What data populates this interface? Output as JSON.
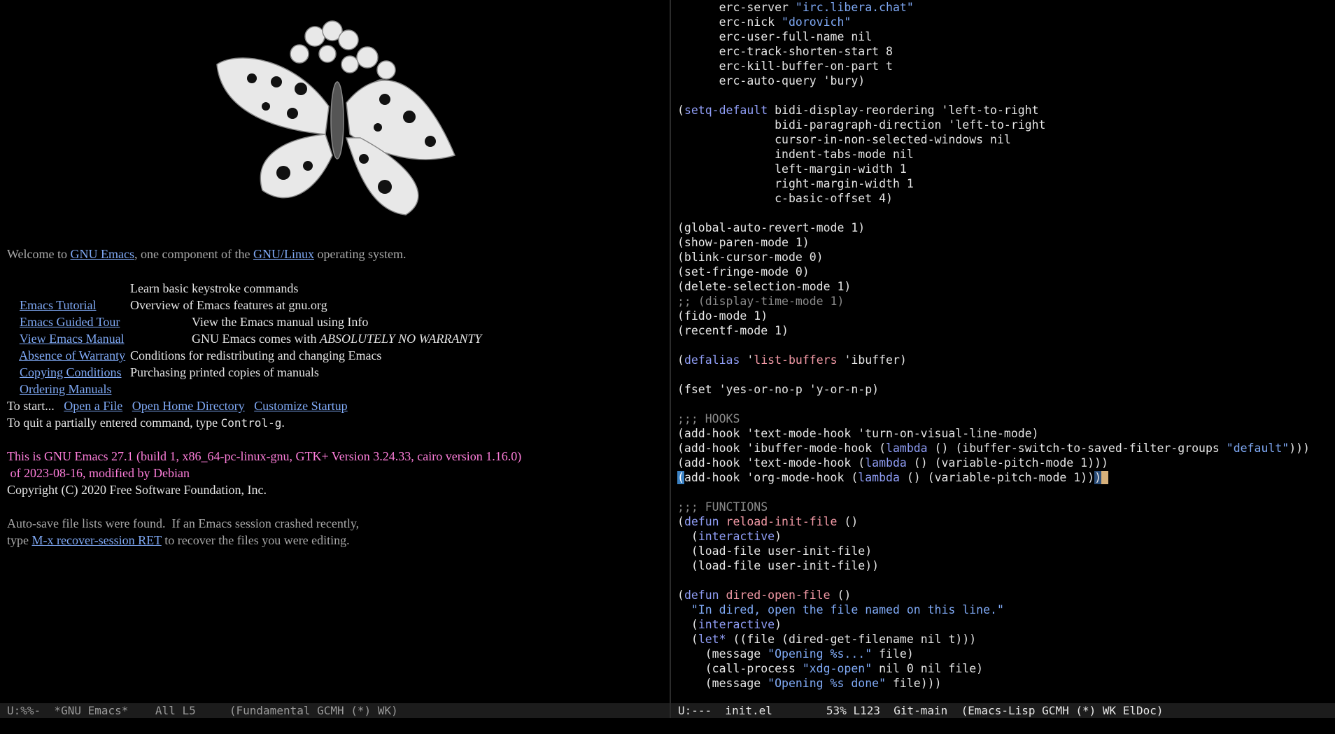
{
  "left": {
    "welcome": {
      "prefix": "Welcome to ",
      "link1": "GNU Emacs",
      "mid": ", one component of the ",
      "link2": "GNU/Linux",
      "suffix": " operating system."
    },
    "menu": [
      {
        "link": "Emacs Tutorial",
        "desc": "Learn basic keystroke commands"
      },
      {
        "link": "Emacs Guided Tour",
        "desc": "Overview of Emacs features at gnu.org"
      },
      {
        "link": "View Emacs Manual",
        "desc": "View the Emacs manual using Info"
      },
      {
        "link": "Absence of Warranty",
        "desc": "GNU Emacs comes with ",
        "desc_em": "ABSOLUTELY NO WARRANTY"
      },
      {
        "link": "Copying Conditions",
        "desc": "Conditions for redistributing and changing Emacs"
      },
      {
        "link": "Ordering Manuals",
        "desc": "Purchasing printed copies of manuals"
      }
    ],
    "start": {
      "prefix": "To start...",
      "open_file": "Open a File",
      "open_home": "Open Home Directory",
      "customize": "Customize Startup"
    },
    "quit": {
      "prefix": "To quit a partially entered command, type ",
      "key": "Control-g",
      "suffix": "."
    },
    "version1": "This is GNU Emacs 27.1 (build 1, x86_64-pc-linux-gnu, GTK+ Version 3.24.33, cairo version 1.16.0)",
    "version2": " of 2023-08-16, modified by Debian",
    "copyright": "Copyright (C) 2020 Free Software Foundation, Inc.",
    "autosave1": "Auto-save file lists were found.  If an Emacs session crashed recently,",
    "autosave2_prefix": "type ",
    "autosave2_link": "M-x recover-session RET",
    "autosave2_suffix": " to recover the files you were editing."
  },
  "modeline_left": "U:%%-  *GNU Emacs*    All L5     (Fundamental GCMH (*) WK)",
  "modeline_right": "U:---  init.el        53% L123  Git-main  (Emacs-Lisp GCMH (*) WK ElDoc)",
  "code_lines": [
    [
      [
        "",
        "      erc-server "
      ],
      [
        "str",
        "\"irc.libera.chat\""
      ]
    ],
    [
      [
        "",
        "      erc-nick "
      ],
      [
        "str",
        "\"dorovich\""
      ]
    ],
    [
      [
        "",
        "      erc-user-full-name nil"
      ]
    ],
    [
      [
        "",
        "      erc-track-shorten-start 8"
      ]
    ],
    [
      [
        "",
        "      erc-kill-buffer-on-part t"
      ]
    ],
    [
      [
        "",
        "      erc-auto-query 'bury)"
      ]
    ],
    [],
    [
      [
        "",
        "("
      ],
      [
        "kw",
        "setq-default"
      ],
      [
        "",
        " bidi-display-reordering 'left-to-right"
      ]
    ],
    [
      [
        "",
        "              bidi-paragraph-direction 'left-to-right"
      ]
    ],
    [
      [
        "",
        "              cursor-in-non-selected-windows nil"
      ]
    ],
    [
      [
        "",
        "              indent-tabs-mode nil"
      ]
    ],
    [
      [
        "",
        "              left-margin-width 1"
      ]
    ],
    [
      [
        "",
        "              right-margin-width 1"
      ]
    ],
    [
      [
        "",
        "              c-basic-offset 4)"
      ]
    ],
    [],
    [
      [
        "",
        "(global-auto-revert-mode 1)"
      ]
    ],
    [
      [
        "",
        "(show-paren-mode 1)"
      ]
    ],
    [
      [
        "",
        "(blink-cursor-mode 0)"
      ]
    ],
    [
      [
        "",
        "(set-fringe-mode 0)"
      ]
    ],
    [
      [
        "",
        "(delete-selection-mode 1)"
      ]
    ],
    [
      [
        "cm",
        ";; (display-time-mode 1)"
      ]
    ],
    [
      [
        "",
        "(fido-mode 1)"
      ]
    ],
    [
      [
        "",
        "(recentf-mode 1)"
      ]
    ],
    [],
    [
      [
        "",
        "("
      ],
      [
        "kw",
        "defalias"
      ],
      [
        "",
        " '"
      ],
      [
        "fn",
        "list-buffers"
      ],
      [
        "",
        " 'ibuffer)"
      ]
    ],
    [],
    [
      [
        "",
        "(fset 'yes-or-no-p 'y-or-n-p)"
      ]
    ],
    [],
    [
      [
        "cm",
        ";;; HOOKS"
      ]
    ],
    [
      [
        "",
        "(add-hook 'text-mode-hook 'turn-on-visual-line-mode)"
      ]
    ],
    [
      [
        "",
        "(add-hook 'ibuffer-mode-hook ("
      ],
      [
        "kw",
        "lambda"
      ],
      [
        "",
        " () (ibuffer-switch-to-saved-filter-groups "
      ],
      [
        "str",
        "\"default\""
      ],
      [
        "",
        ")))"
      ]
    ],
    [
      [
        "",
        "(add-hook 'text-mode-hook ("
      ],
      [
        "kw",
        "lambda"
      ],
      [
        "",
        " () (variable-pitch-mode 1)))"
      ]
    ],
    [
      [
        "cursor",
        "("
      ],
      [
        "",
        "add-hook 'org-mode-hook ("
      ],
      [
        "kw",
        "lambda"
      ],
      [
        "",
        " () (variable-pitch-mode 1))"
      ],
      [
        "hl-paren",
        ")"
      ],
      [
        "cursor2",
        " "
      ]
    ],
    [],
    [
      [
        "cm",
        ";;; FUNCTIONS"
      ]
    ],
    [
      [
        "",
        "("
      ],
      [
        "kw",
        "defun"
      ],
      [
        "",
        " "
      ],
      [
        "fn",
        "reload-init-file"
      ],
      [
        "",
        " ()"
      ]
    ],
    [
      [
        "",
        "  ("
      ],
      [
        "kw",
        "interactive"
      ],
      [
        "",
        ")"
      ]
    ],
    [
      [
        "",
        "  (load-file user-init-file)"
      ]
    ],
    [
      [
        "",
        "  (load-file user-init-file))"
      ]
    ],
    [],
    [
      [
        "",
        "("
      ],
      [
        "kw",
        "defun"
      ],
      [
        "",
        " "
      ],
      [
        "fn",
        "dired-open-file"
      ],
      [
        "",
        " ()"
      ]
    ],
    [
      [
        "",
        "  "
      ],
      [
        "str",
        "\"In dired, open the file named on this line.\""
      ]
    ],
    [
      [
        "",
        "  ("
      ],
      [
        "kw",
        "interactive"
      ],
      [
        "",
        ")"
      ]
    ],
    [
      [
        "",
        "  ("
      ],
      [
        "kw",
        "let*"
      ],
      [
        "",
        " ((file (dired-get-filename nil t)))"
      ]
    ],
    [
      [
        "",
        "    (message "
      ],
      [
        "str",
        "\"Opening %s...\""
      ],
      [
        "",
        " file)"
      ]
    ],
    [
      [
        "",
        "    (call-process "
      ],
      [
        "str",
        "\"xdg-open\""
      ],
      [
        "",
        " nil 0 nil file)"
      ]
    ],
    [
      [
        "",
        "    (message "
      ],
      [
        "str",
        "\"Opening %s done\""
      ],
      [
        "",
        " file)))"
      ]
    ]
  ]
}
